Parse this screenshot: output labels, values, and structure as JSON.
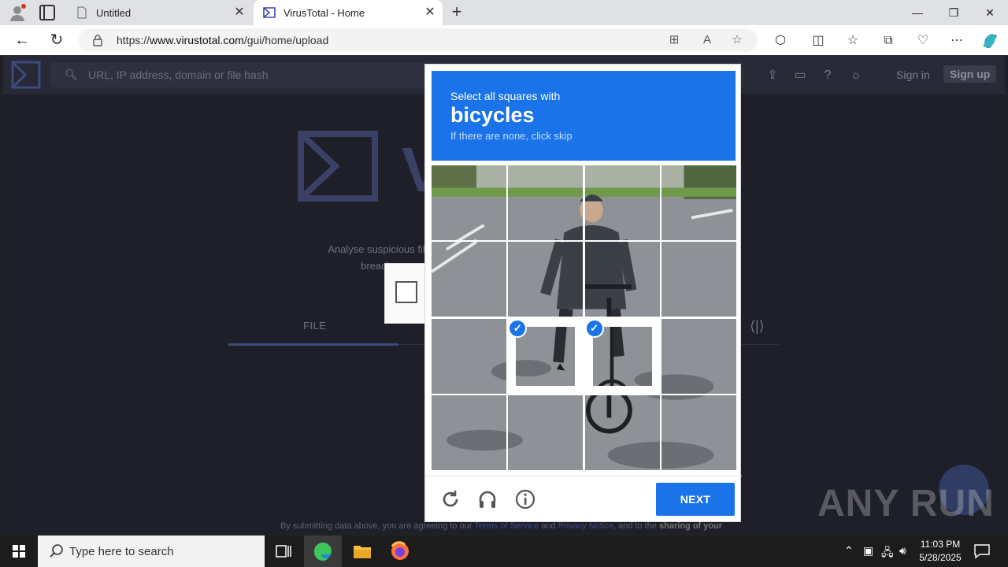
{
  "browser": {
    "tabs": [
      {
        "title": "Untitled"
      },
      {
        "title": "VirusTotal - Home"
      }
    ],
    "url_prefix": "https://",
    "url_host": "www.virustotal.com",
    "url_path": "/gui/home/upload"
  },
  "virustotal": {
    "search_placeholder": "URL, IP address, domain or file hash",
    "sign_in": "Sign in",
    "sign_up": "Sign up",
    "brand_partial": "V",
    "description": "Analyse suspicious fil breach",
    "tab_file": "FILE",
    "footer_text_1": "By submitting data above, you are agreeing to our ",
    "footer_terms": "Terms of Service",
    "footer_and": " and ",
    "footer_privacy": "Privacy Notice",
    "footer_text_2": ", and to the ",
    "footer_sharing": "sharing of your"
  },
  "captcha": {
    "prompt_line1": "Select all squares with",
    "prompt_object": "bicycles",
    "prompt_line3": "If there are none, click skip",
    "next_label": "NEXT",
    "grid_cols": 4,
    "selected_cells": [
      9,
      10
    ]
  },
  "watermark": {
    "text": "ANY RUN"
  },
  "taskbar": {
    "search_placeholder": "Type here to search",
    "time": "11:03 PM",
    "date": "5/28/2025"
  },
  "colors": {
    "captcha_blue": "#1a73e8",
    "vt_bg": "#1e1f29",
    "vt_accent": "#3e4a80"
  }
}
